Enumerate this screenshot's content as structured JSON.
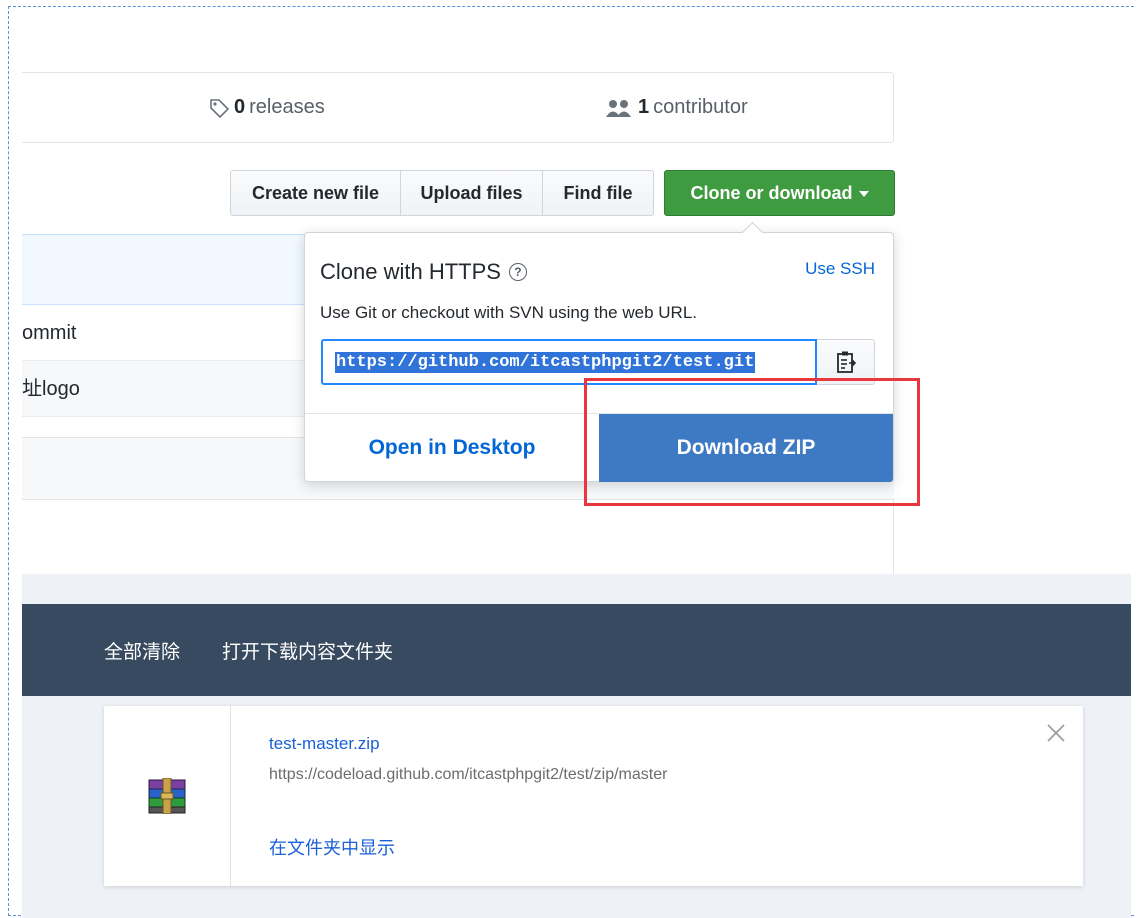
{
  "github": {
    "stats": {
      "releases_count": "0",
      "releases_label": "releases",
      "contributors_count": "1",
      "contributors_label": "contributor"
    },
    "toolbar": {
      "create_file": "Create new file",
      "upload_files": "Upload files",
      "find_file": "Find file",
      "clone_download": "Clone or download"
    },
    "files": {
      "row1_text": "ommit",
      "row2_text": "址logo"
    },
    "clone_panel": {
      "title": "Clone with HTTPS",
      "help_glyph": "?",
      "use_ssh": "Use SSH",
      "description": "Use Git or checkout with SVN using the web URL.",
      "url": "https://github.com/itcastphpgit2/test.git",
      "open_desktop": "Open in Desktop",
      "download_zip": "Download ZIP"
    }
  },
  "downloads": {
    "clear_all": "全部清除",
    "open_folder": "打开下载内容文件夹",
    "item": {
      "filename": "test-master.zip",
      "url": "https://codeload.github.com/itcastphpgit2/test/zip/master",
      "show_in_folder": "在文件夹中显示",
      "icon": "winrar-archive-icon"
    }
  },
  "colors": {
    "clone_green": "#3f9b3f",
    "download_blue": "#3e79c3",
    "link_blue": "#0366d6",
    "highlight_red": "#e8383d",
    "downloads_bar": "#384a5f"
  }
}
